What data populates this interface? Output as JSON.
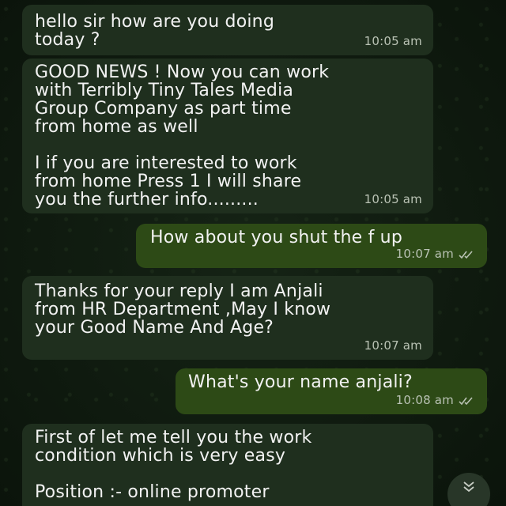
{
  "messages": [
    {
      "direction": "incoming",
      "text": "hello sir how are you doing\ntoday ?",
      "time": "10:05 am"
    },
    {
      "direction": "incoming",
      "text": "GOOD NEWS ! Now you can work\nwith Terribly Tiny Tales Media\nGroup Company as part time\nfrom home as well\n\n  I  if you are interested to work\nfrom home Press 1 I will share\nyou the further info.........",
      "time": "10:05 am"
    },
    {
      "direction": "outgoing",
      "text": "How about you shut the f up",
      "time": "10:07 am",
      "status": "read"
    },
    {
      "direction": "incoming",
      "text": "Thanks for your reply I am Anjali\nfrom HR Department ,May I know\nyour Good Name And Age?",
      "time": "10:07 am"
    },
    {
      "direction": "outgoing",
      "text": "What's your name anjali?",
      "time": "10:08 am",
      "status": "read"
    },
    {
      "direction": "incoming",
      "text": "First of let me tell you the work\ncondition which is very easy\n\nPosition :- online promoter",
      "time": ""
    }
  ],
  "scroll_button": {
    "icon": "double-chevron-down-icon"
  },
  "colors": {
    "incoming_bubble": "#1f2f1e",
    "outgoing_bubble": "#2d4a16",
    "text": "#f2f2f2",
    "meta_text": "#b9c2b4"
  }
}
